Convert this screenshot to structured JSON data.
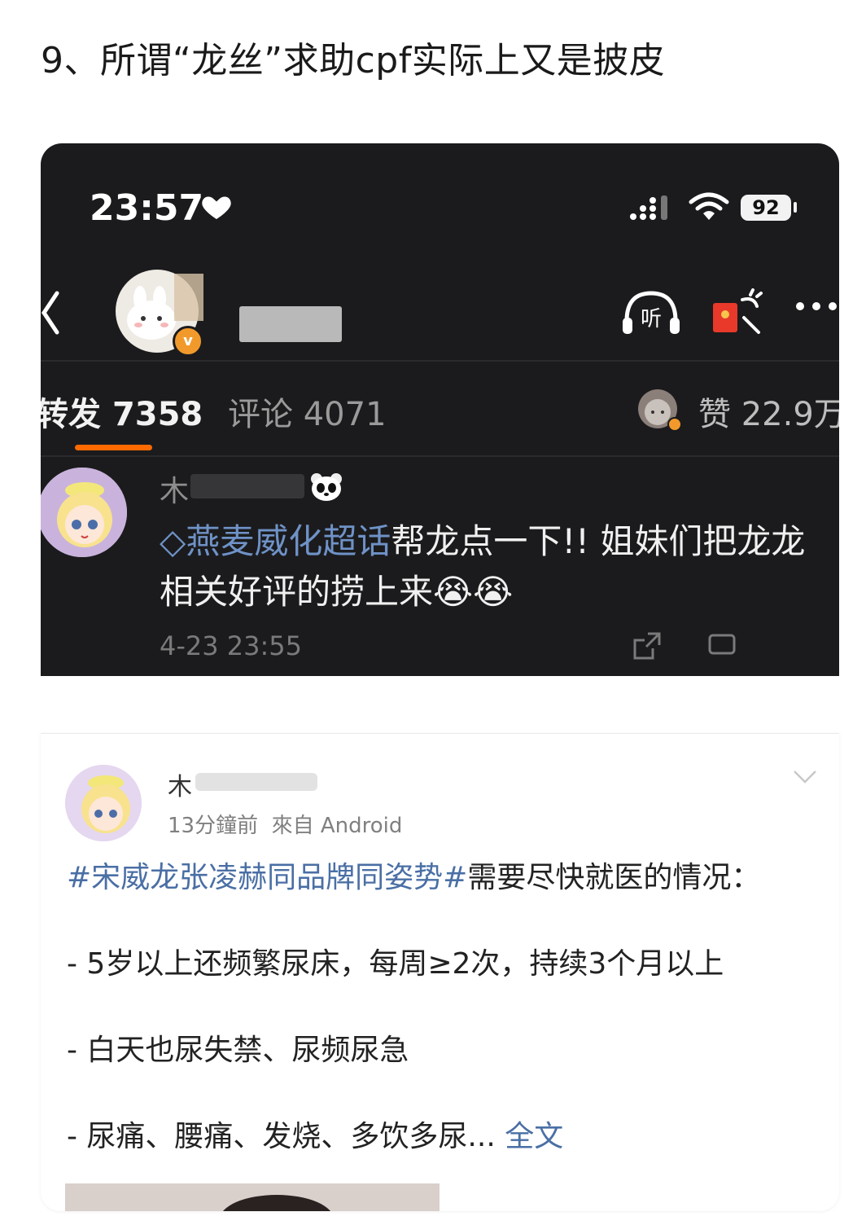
{
  "heading": "9、所谓“龙丝”求助cpf实际上又是披皮",
  "status_bar": {
    "time": "23:57",
    "battery": "92"
  },
  "header": {
    "listen_label": "听"
  },
  "tabs": {
    "repost_label": "转发",
    "repost_count": "7358",
    "comment_label": "评论",
    "comment_count": "4071",
    "like_label": "赞",
    "like_count": "22.9万"
  },
  "comment": {
    "username": "木",
    "topic": "燕麦威化超话",
    "text": "帮龙点一下!! 姐妹们把龙龙相关好评的捞上来",
    "emojis": "😭😭",
    "date": "4-23 23:55"
  },
  "post": {
    "username": "木",
    "time": "13分鐘前",
    "source": "來自 Android",
    "topic": "#宋威龙张凌赫同品牌同姿势#",
    "intro": "需要尽快就医的情况：",
    "line1": "- 5岁以上还频繁尿床，每周≥2次，持续3个月以上",
    "line2": "- 白天也尿失禁、尿频尿急",
    "line3": "- 尿痛、腰痛、发烧、多饮多尿...",
    "full_link": "全文"
  },
  "colors": {
    "accent": "#ff6a00",
    "topic_link": "#4a6fa5",
    "dark_bg": "#1b1b1d"
  }
}
